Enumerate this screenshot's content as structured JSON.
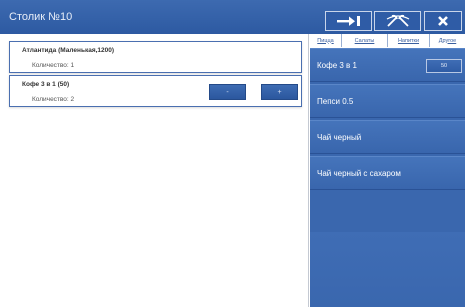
{
  "window": {
    "title": "Столик №10"
  },
  "toolbar": {
    "icons": [
      "transfer-icon",
      "tools-icon",
      "close-icon"
    ]
  },
  "order": {
    "items": [
      {
        "name": "Атлантида (Маленькая,1200)",
        "quantity_text": "Количество: 1"
      },
      {
        "name": "Кофе 3 в 1 (50)",
        "quantity_text": "Количество: 2",
        "minus_label": "-",
        "plus_label": "+"
      }
    ]
  },
  "categories": {
    "tabs": [
      "Пицца",
      "Салаты",
      "Напитки",
      "Другое"
    ]
  },
  "products": [
    {
      "label": "Кофе 3 в 1",
      "badge": "50"
    },
    {
      "label": "Пепси 0.5"
    },
    {
      "label": "Чай черный"
    },
    {
      "label": "Чай черный с сахаром"
    }
  ],
  "colors": {
    "accent": "#3a67ae",
    "titlebar": "#2d5aa2",
    "border": "#4a6fb0"
  }
}
